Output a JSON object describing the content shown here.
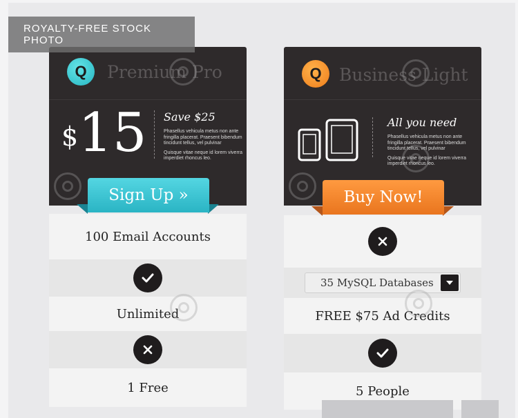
{
  "badge": {
    "label": "ROYALTY-FREE STOCK PHOTO"
  },
  "plans": {
    "premium": {
      "logo_letter": "Q",
      "name": "Premium Pro",
      "currency": "$",
      "price": "15",
      "promo_title": "Save $25",
      "fine_1": "Phasellus vehicula metus non ante fringilla placerat. Praesent bibendum tincidunt tellus, vel pulvinar",
      "fine_2": "Quisque vitae neque id lorem viverra imperdiet rhoncus leo.",
      "cta": "Sign Up »",
      "rows": {
        "email": "100 Email Accounts",
        "unlimited": "Unlimited",
        "free": "1 Free"
      }
    },
    "business": {
      "logo_letter": "Q",
      "name": "Business Light",
      "promo_title": "All you need",
      "fine_1": "Phasellus vehicula metus non ante fringilla placerat. Praesent bibendum tincidunt tellus, vel pulvinar",
      "fine_2": "Quisque vitae neque id lorem viverra imperdiet rhoncus leo.",
      "cta": "Buy Now!",
      "rows": {
        "databases": "35 MySQL Databases",
        "credits": "FREE $75 Ad Credits",
        "people": "5 People"
      }
    }
  },
  "colors": {
    "teal": "#2ab4c4",
    "orange": "#ee7d1b",
    "card_dark": "#2e2a2b"
  },
  "icons": {
    "check": "check-icon",
    "cross": "cross-icon",
    "chevron": "chevron-down-icon",
    "watermark": "dreamstime-spiral-icon"
  }
}
